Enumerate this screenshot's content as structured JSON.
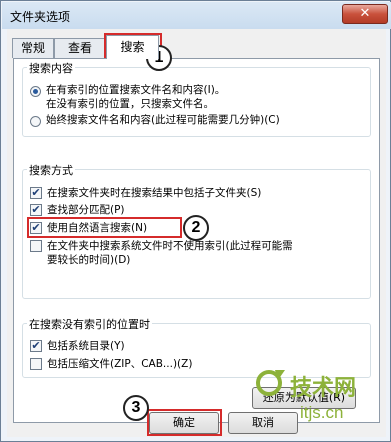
{
  "window": {
    "title": "文件夹选项",
    "close_glyph": "✕"
  },
  "tabs": [
    {
      "label": "常规"
    },
    {
      "label": "查看"
    },
    {
      "label": "搜索",
      "active": true
    }
  ],
  "search_content": {
    "title": "搜索内容",
    "option1_line1": "在有索引的位置搜索文件名和内容(I)。",
    "option1_line2": "在没有索引的位置，只搜索文件名。",
    "option2": "始终搜索文件名和内容(此过程可能需要几分钟)(C)"
  },
  "search_method": {
    "title": "搜索方式",
    "opt1": "在搜索文件夹时在搜索结果中包括子文件夹(S)",
    "opt2": "查找部分匹配(P)",
    "opt3": "使用自然语言搜索(N)",
    "opt4_line1": "在文件夹中搜索系统文件时不使用索引(此过程可能需",
    "opt4_line2": "要较长的时间)(D)"
  },
  "no_index": {
    "title": "在搜索没有索引的位置时",
    "opt1": "包括系统目录(Y)",
    "opt2": "包括压缩文件(ZIP、CAB...)(Z)"
  },
  "buttons": {
    "restore": "还原为默认值(R)",
    "ok": "确定",
    "cancel": "取消"
  },
  "check_glyph": "✔",
  "annotations": {
    "b1": "1",
    "b2": "2",
    "b3": "3"
  },
  "watermark": {
    "brand": "技术网",
    "url": "itjs.cn"
  },
  "colors": {
    "highlight": "#d52b2b",
    "accent": "#2a5a9c",
    "watermark": "#8db23a"
  }
}
